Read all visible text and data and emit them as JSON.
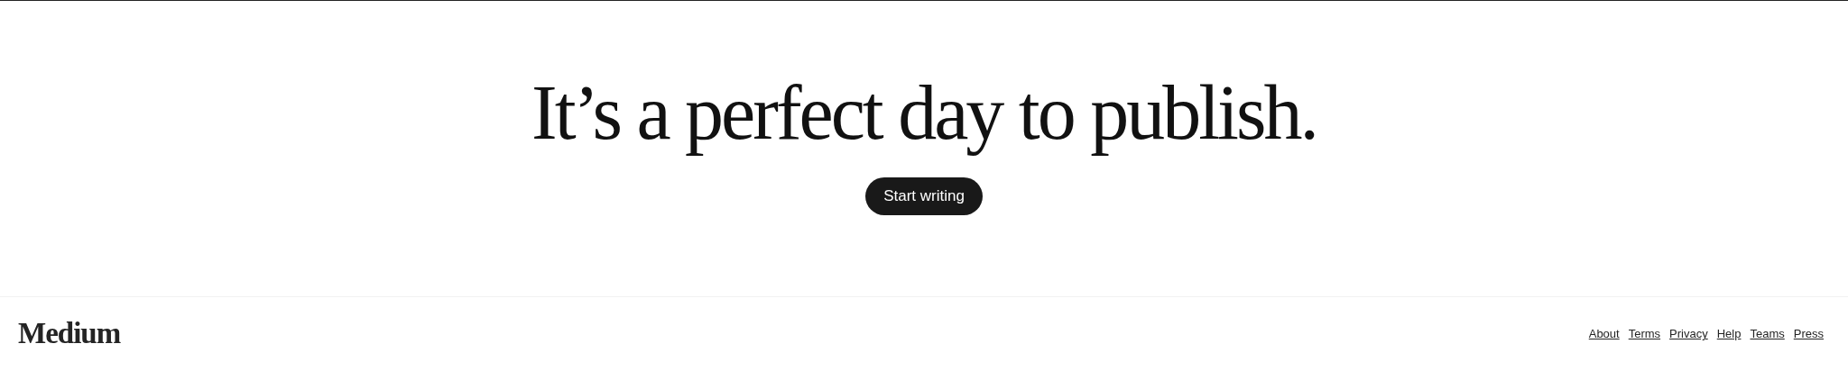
{
  "hero": {
    "heading": "It’s a perfect day to publish.",
    "button": "Start writing"
  },
  "footer": {
    "logo": "Medium",
    "links": [
      "About",
      "Terms",
      "Privacy",
      "Help",
      "Teams",
      "Press"
    ]
  }
}
